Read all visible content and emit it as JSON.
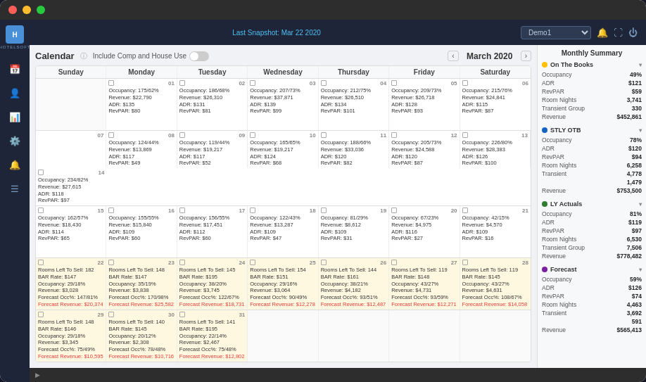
{
  "window": {
    "title": "HotelSoft"
  },
  "topbar": {
    "snapshot_label": "Last Snapshot: Mar 22 2020",
    "demo_option": "Demo1"
  },
  "calendar": {
    "title": "Calendar",
    "include_comp_label": "Include Comp and House Use",
    "month_label": "March 2020",
    "day_headers": [
      "Sunday",
      "Monday",
      "Tuesday",
      "Wednesday",
      "Thursday",
      "Friday",
      "Saturday"
    ]
  },
  "weeks": [
    [
      {
        "num": "",
        "empty": true,
        "lines": []
      },
      {
        "num": "01",
        "lines": [
          "Occupancy: 175/62%",
          "Revenue: $22,790",
          "ADR: $135",
          "RevPAR: $80"
        ]
      },
      {
        "num": "02",
        "lines": [
          "Occupancy: 186/68%",
          "Revenue: $26,310",
          "ADR: $131",
          "RevPAR: $81"
        ]
      },
      {
        "num": "03",
        "lines": [
          "Occupancy: 207/73%",
          "Revenue: $37,871",
          "ADR: $139",
          "RevPAR: $99"
        ]
      },
      {
        "num": "04",
        "lines": [
          "Occupancy: 212/75%",
          "Revenue: $26,510",
          "ADR: $134",
          "RevPAR: $101"
        ]
      },
      {
        "num": "05",
        "lines": [
          "Occupancy: 209/73%",
          "Revenue: $26,718",
          "ADR: $128",
          "RevPAR: $93"
        ]
      },
      {
        "num": "06",
        "lines": [
          "Occupancy: 215/76%",
          "Revenue: $24,841",
          "ADR: $115",
          "RevPAR: $87"
        ]
      }
    ],
    [
      {
        "num": "07",
        "empty": false,
        "lines": []
      },
      {
        "num": "08",
        "lines": [
          "Occupancy: 124/44%",
          "Revenue: $13,869",
          "ADR: $117",
          "RevPAR: $49"
        ]
      },
      {
        "num": "09",
        "lines": [
          "Occupancy: 119/44%",
          "Revenue: $19,217",
          "ADR: $117",
          "RevPAR: $52"
        ]
      },
      {
        "num": "10",
        "lines": [
          "Occupancy: 165/65%",
          "Revenue: $19,217",
          "ADR: $124",
          "RevPAR: $68"
        ]
      },
      {
        "num": "11",
        "lines": [
          "Occupancy: 188/66%",
          "Revenue: $33,036",
          "ADR: $120",
          "RevPAR: $82"
        ]
      },
      {
        "num": "12",
        "lines": [
          "Occupancy: 205/73%",
          "Revenue: $24,588",
          "ADR: $120",
          "RevPAR: $87"
        ]
      },
      {
        "num": "13",
        "lines": [
          "Occupancy: 226/80%",
          "Revenue: $28,383",
          "ADR: $126",
          "RevPAR: $100"
        ]
      },
      {
        "num": "14",
        "lines": [
          "Occupancy: 234/82%",
          "Revenue: $27,615",
          "ADR: $118",
          "RevPAR: $97"
        ]
      }
    ],
    [
      {
        "num": "15",
        "lines": [
          "Occupancy: 162/57%",
          "Revenue: $18,430",
          "ADR: $114",
          "RevPAR: $65"
        ]
      },
      {
        "num": "16",
        "lines": [
          "Occupancy: 155/55%",
          "Revenue: $15,840",
          "ADR: $109",
          "RevPAR: $60"
        ]
      },
      {
        "num": "17",
        "lines": [
          "Occupancy: 156/55%",
          "Revenue: $17,451",
          "ADR: $112",
          "RevPAR: $60"
        ]
      },
      {
        "num": "18",
        "lines": [
          "Occupancy: 122/43%",
          "Revenue: $13,287",
          "ADR: $109",
          "RevPAR: $47"
        ]
      },
      {
        "num": "19",
        "lines": [
          "Occupancy: 81/29%",
          "Revenue: $8,612",
          "ADR: $109",
          "RevPAR: $31"
        ]
      },
      {
        "num": "20",
        "lines": [
          "Occupancy: 67/23%",
          "Revenue: $4,975",
          "ADR: $116",
          "RevPAR: $27"
        ]
      },
      {
        "num": "21",
        "lines": [
          "Occupancy: 42/15%",
          "Revenue: $4,570",
          "ADR: $109",
          "RevPAR: $16"
        ]
      }
    ],
    [
      {
        "num": "22",
        "highlighted": true,
        "lines": [
          "Rooms Left To Sell: 182",
          "BAR Rate: $147",
          "Occupancy: 29/18%",
          "Revenue: $3,028",
          "Forecast Occ%: 147/81%",
          "Forecast Revenue: $20,374"
        ]
      },
      {
        "num": "23",
        "highlighted": true,
        "lines": [
          "Rooms Left To Sell: 148",
          "BAR Rate: $147",
          "Occupancy: 35/19%",
          "Revenue: $3,838",
          "Forecast Occ%: 170/98%",
          "Forecast Revenue: $25,582"
        ]
      },
      {
        "num": "24",
        "highlighted": true,
        "lines": [
          "Rooms Left To Sell: 145",
          "BAR Rate: $195",
          "Occupancy: 38/20%",
          "Revenue: $3,745",
          "Forecast Occ%: 122/67%",
          "Forecast Revenue: $18,731"
        ]
      },
      {
        "num": "25",
        "highlighted": true,
        "lines": [
          "Rooms Left To Sell: 154",
          "BAR Rate: $151",
          "Occupancy: 29/16%",
          "Revenue: $3,064",
          "Forecast Occ%: 90/49%",
          "Forecast Revenue: $12,278"
        ]
      },
      {
        "num": "26",
        "highlighted": true,
        "lines": [
          "Rooms Left To Sell: 144",
          "BAR Rate: $161",
          "Occupancy: 38/21%",
          "Revenue: $4,182",
          "Forecast Occ%: 93/51%",
          "Forecast Revenue: $12,487"
        ]
      },
      {
        "num": "27",
        "highlighted": true,
        "lines": [
          "Rooms Left To Sell: 119",
          "BAR Rate: $148",
          "Occupancy: 43/27%",
          "Revenue: $4,731",
          "Forecast Occ%: 93/59%",
          "Forecast Revenue: $12,271"
        ]
      },
      {
        "num": "28",
        "highlighted": true,
        "lines": [
          "Rooms Left To Sell: 119",
          "BAR Rate: $145",
          "Occupancy: 43/27%",
          "Revenue: $4,631",
          "Forecast Occ%: 108/67%",
          "Forecast Revenue: $14,058"
        ]
      }
    ],
    [
      {
        "num": "29",
        "highlighted": true,
        "lines": [
          "Rooms Left To Sell: 148",
          "BAR Rate: $146",
          "Occupancy: 29/18%",
          "Revenue: $3,345",
          "Forecast Occ%: 75/49%",
          "Forecast Revenue: $10,595"
        ]
      },
      {
        "num": "30",
        "highlighted": true,
        "lines": [
          "Rooms Left To Sell: 140",
          "BAR Rate: $145",
          "Occupancy: 20/12%",
          "Revenue: $2,308",
          "Forecast Occ%: 78/48%",
          "Forecast Revenue: $10,716"
        ]
      },
      {
        "num": "31",
        "highlighted": true,
        "lines": [
          "Rooms Left To Sell: 141",
          "BAR Rate: $195",
          "Occupancy: 22/14%",
          "Revenue: $2,467",
          "Forecast Occ%: 75/48%",
          "Forecast Revenue: $12,802"
        ]
      },
      {
        "num": "",
        "empty": true,
        "lines": []
      },
      {
        "num": "",
        "empty": true,
        "lines": []
      },
      {
        "num": "",
        "empty": true,
        "lines": []
      },
      {
        "num": "",
        "empty": true,
        "lines": []
      }
    ]
  ],
  "right_panel": {
    "title": "Monthly Summary",
    "sections": [
      {
        "id": "on_the_books",
        "label": "On The Books",
        "dot": "yellow",
        "metrics": [
          {
            "label": "Occupancy",
            "value": "49%"
          },
          {
            "label": "ADR",
            "value": "$121"
          },
          {
            "label": "RevPAR",
            "value": "$59"
          },
          {
            "label": "Room Nights",
            "value": "3,741"
          },
          {
            "label": "Transient Group",
            "value": "330"
          },
          {
            "label": "Revenue",
            "value": "$452,861"
          }
        ]
      },
      {
        "id": "stly_otb",
        "label": "STLY OTB",
        "dot": "blue",
        "metrics": [
          {
            "label": "Occupancy",
            "value": "78%"
          },
          {
            "label": "ADR",
            "value": "$120"
          },
          {
            "label": "RevPAR",
            "value": "$94"
          },
          {
            "label": "Room Nights",
            "value": "6,258"
          },
          {
            "label": "Transient",
            "value": "4,778"
          },
          {
            "label": "",
            "value": "1,479"
          },
          {
            "label": "Revenue",
            "value": "$753,500"
          }
        ]
      },
      {
        "id": "ly_actuals",
        "label": "LY Actuals",
        "dot": "green",
        "metrics": [
          {
            "label": "Occupancy",
            "value": "81%"
          },
          {
            "label": "ADR",
            "value": "$119"
          },
          {
            "label": "RevPAR",
            "value": "$97"
          },
          {
            "label": "Room Nights",
            "value": "6,530"
          },
          {
            "label": "Transient Group",
            "value": "7,506"
          },
          {
            "label": "Revenue",
            "value": "$778,482"
          }
        ]
      },
      {
        "id": "forecast",
        "label": "Forecast",
        "dot": "purple",
        "metrics": [
          {
            "label": "Occupancy",
            "value": "59%"
          },
          {
            "label": "ADR",
            "value": "$126"
          },
          {
            "label": "RevPAR",
            "value": "$74"
          },
          {
            "label": "Room Nights",
            "value": "4,463"
          },
          {
            "label": "Transient",
            "value": "3,692"
          },
          {
            "label": "",
            "value": "591"
          },
          {
            "label": "Revenue",
            "value": "$565,413"
          }
        ]
      }
    ]
  },
  "sidebar": {
    "icons": [
      "🏨",
      "📅",
      "👤",
      "📊",
      "🔔",
      "⚙️",
      "📋"
    ]
  }
}
